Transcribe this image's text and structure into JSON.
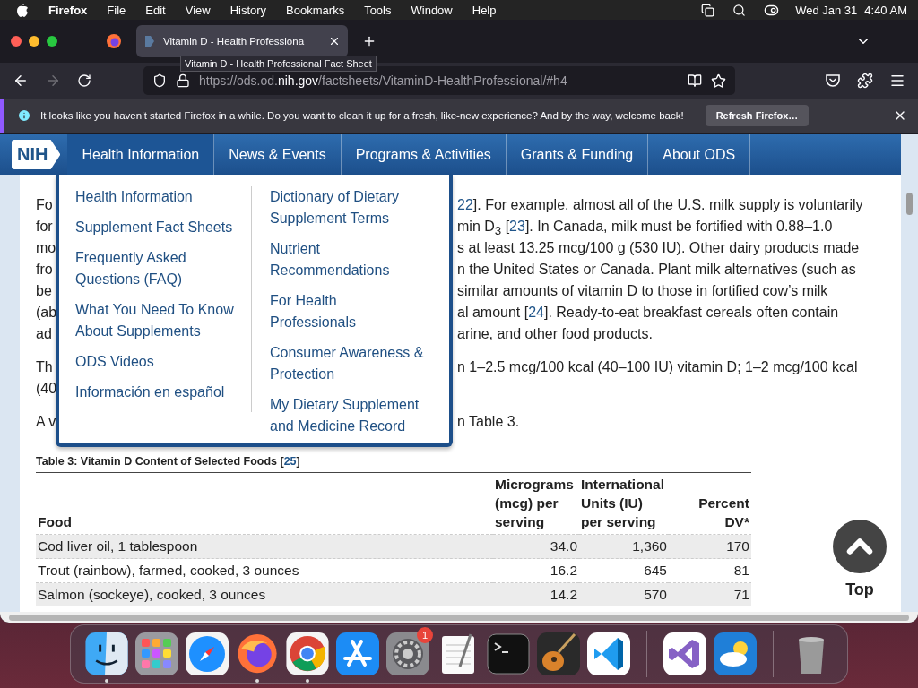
{
  "menubar": {
    "app": "Firefox",
    "menus": [
      "File",
      "Edit",
      "View",
      "History",
      "Bookmarks",
      "Tools",
      "Window",
      "Help"
    ],
    "date": "Wed Jan 31",
    "time": "4:40 AM"
  },
  "tabs": [
    {
      "title": "Vitamin D - Health Professiona",
      "selected": true
    }
  ],
  "tooltip": "Vitamin D - Health Professional Fact Sheet",
  "toolbar": {
    "forward_disabled": true
  },
  "url": {
    "prefix": "https://ods.od.",
    "domain": "nih.gov",
    "path": "/factsheets/VitaminD-HealthProfessional/#h4"
  },
  "notification": {
    "message": "It looks like you haven’t started Firefox in a while. Do you want to clean it up for a fresh, like-new experience? And by the way, welcome back!",
    "button": "Refresh Firefox…"
  },
  "site": {
    "logo": "NIH",
    "nav": [
      {
        "label": "Health Information",
        "selected": true
      },
      {
        "label": "News & Events",
        "selected": false
      },
      {
        "label": "Programs & Activities",
        "selected": false
      },
      {
        "label": "Grants & Funding",
        "selected": false
      },
      {
        "label": "About ODS",
        "selected": false
      }
    ]
  },
  "dropdown": {
    "columns": [
      [
        "Health Information",
        "Supplement Fact Sheets",
        "Frequently Asked\nQuestions (FAQ)",
        "What You Need To Know\nAbout Supplements",
        "ODS Videos",
        "Información en español"
      ],
      [
        "Dictionary of Dietary\nSupplement Terms",
        "Nutrient\nRecommendations",
        "For Health\nProfessionals",
        "Consumer Awareness &\nProtection",
        "My Dietary Supplement\nand Medicine Record"
      ]
    ]
  },
  "article": {
    "paragraphs": [
      {
        "lines": [
          {
            "left": "Fo",
            "right": [
              {
                "text": "22",
                "kind": "link"
              },
              {
                "text": "]. For example, almost all of the U.S. milk supply is voluntarily",
                "kind": "text"
              }
            ]
          },
          {
            "left": "for",
            "right": [
              {
                "text": "min D$_{3}$ [",
                "kind": "text"
              },
              {
                "text": "23",
                "kind": "link"
              },
              {
                "text": "]. In Canada, milk must be fortified with 0.88–1.0",
                "kind": "text"
              }
            ]
          },
          {
            "left": "mo",
            "right": [
              {
                "text": "s at least 13.25 mcg/100 g (530 IU). Other dairy products made",
                "kind": "text"
              }
            ]
          },
          {
            "left": "fro",
            "right": [
              {
                "text": "n the United States or Canada. Plant milk alternatives (such as",
                "kind": "text"
              }
            ]
          },
          {
            "left": "be",
            "right": [
              {
                "text": " similar amounts of vitamin D to those in fortified cow’s milk",
                "kind": "text"
              }
            ]
          },
          {
            "left": "(ab",
            "right": [
              {
                "text": "al amount [",
                "kind": "text"
              },
              {
                "text": "24",
                "kind": "link"
              },
              {
                "text": "]. Ready-to-eat breakfast cereals often contain",
                "kind": "text"
              }
            ]
          },
          {
            "left": "ad",
            "right": [
              {
                "text": "arine, and other food products.",
                "kind": "text"
              }
            ]
          }
        ]
      },
      {
        "lines": [
          {
            "left": "Th",
            "right": [
              {
                "text": "n 1–2.5 mcg/100 kcal (40–100 IU) vitamin D; 1–2 mcg/100 kcal",
                "kind": "text"
              }
            ]
          },
          {
            "left": "(40"
          }
        ]
      },
      {
        "lines": [
          {
            "left": "A v",
            "right": [
              {
                "text": "n Table 3.",
                "kind": "text"
              }
            ]
          }
        ]
      }
    ]
  },
  "table": {
    "title": {
      "before": "Table 3: Vitamin D Content of Selected Foods [",
      "link": "25",
      "after": "]"
    },
    "columns": [
      "Food",
      "Micrograms\n(mcg) per\nserving",
      "International\nUnits (IU)\nper serving",
      "Percent DV*"
    ],
    "rows": [
      [
        "Cod liver oil, 1 tablespoon",
        "34.0",
        "1,360",
        "170"
      ],
      [
        "Trout (rainbow), farmed, cooked, 3 ounces",
        "16.2",
        "645",
        "81"
      ],
      [
        "Salmon (sockeye), cooked, 3 ounces",
        "14.2",
        "570",
        "71"
      ]
    ]
  },
  "back_to_top": "Top",
  "dock": [
    {
      "kind": "finder",
      "running": true
    },
    {
      "kind": "launchpad",
      "running": false
    },
    {
      "kind": "safari",
      "running": false
    },
    {
      "kind": "firefox",
      "running": true
    },
    {
      "kind": "chrome",
      "running": true
    },
    {
      "kind": "appstore",
      "running": false
    },
    {
      "kind": "settings",
      "running": false,
      "badge": "1"
    },
    {
      "kind": "textedit",
      "running": false
    },
    {
      "kind": "terminal",
      "running": false
    },
    {
      "kind": "guitar",
      "running": false
    },
    {
      "kind": "vscode",
      "running": false
    },
    {
      "kind": "divider"
    },
    {
      "kind": "vs",
      "running": false
    },
    {
      "kind": "weather",
      "running": false
    },
    {
      "kind": "divider"
    },
    {
      "kind": "trash",
      "running": false
    }
  ]
}
